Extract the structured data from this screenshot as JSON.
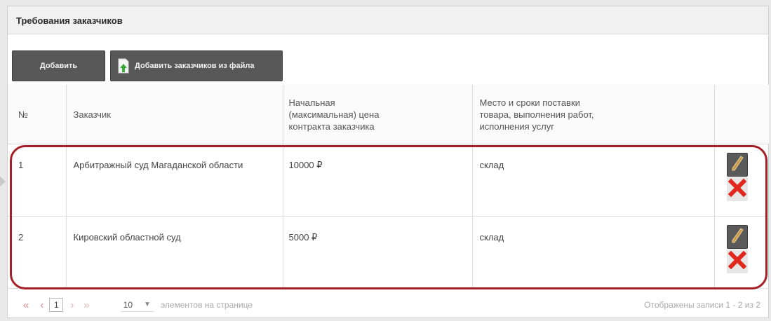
{
  "panel": {
    "title": "Требования заказчиков"
  },
  "toolbar": {
    "add_label": "Добавить",
    "add_from_file_label": "Добавить заказчиков из файла"
  },
  "table": {
    "headers": {
      "num": "№",
      "customer": "Заказчик",
      "price": [
        "Начальная",
        "(максимальная) цена",
        "контракта заказчика"
      ],
      "place": [
        "Место и сроки поставки",
        "товара, выполнения работ,",
        "исполнения услуг"
      ]
    },
    "rows": [
      {
        "num": "1",
        "customer": "Арбитражный суд Магаданской области",
        "price": "10000 ₽",
        "place": "склад"
      },
      {
        "num": "2",
        "customer": "Кировский областной суд",
        "price": "5000 ₽",
        "place": "склад"
      }
    ]
  },
  "pager": {
    "first": "«",
    "prev": "‹",
    "current_page": "1",
    "next": "›",
    "last": "»",
    "page_size": "10",
    "per_page_label": "элементов на странице",
    "records_label": "Отображены записи 1 - 2 из 2"
  },
  "icons": {
    "edit": "pencil-icon",
    "delete": "red-x-icon",
    "file": "file-upload-icon"
  },
  "colors": {
    "highlight": "#a51e28",
    "button": "#585858",
    "pager_link": "#d98a8a"
  }
}
